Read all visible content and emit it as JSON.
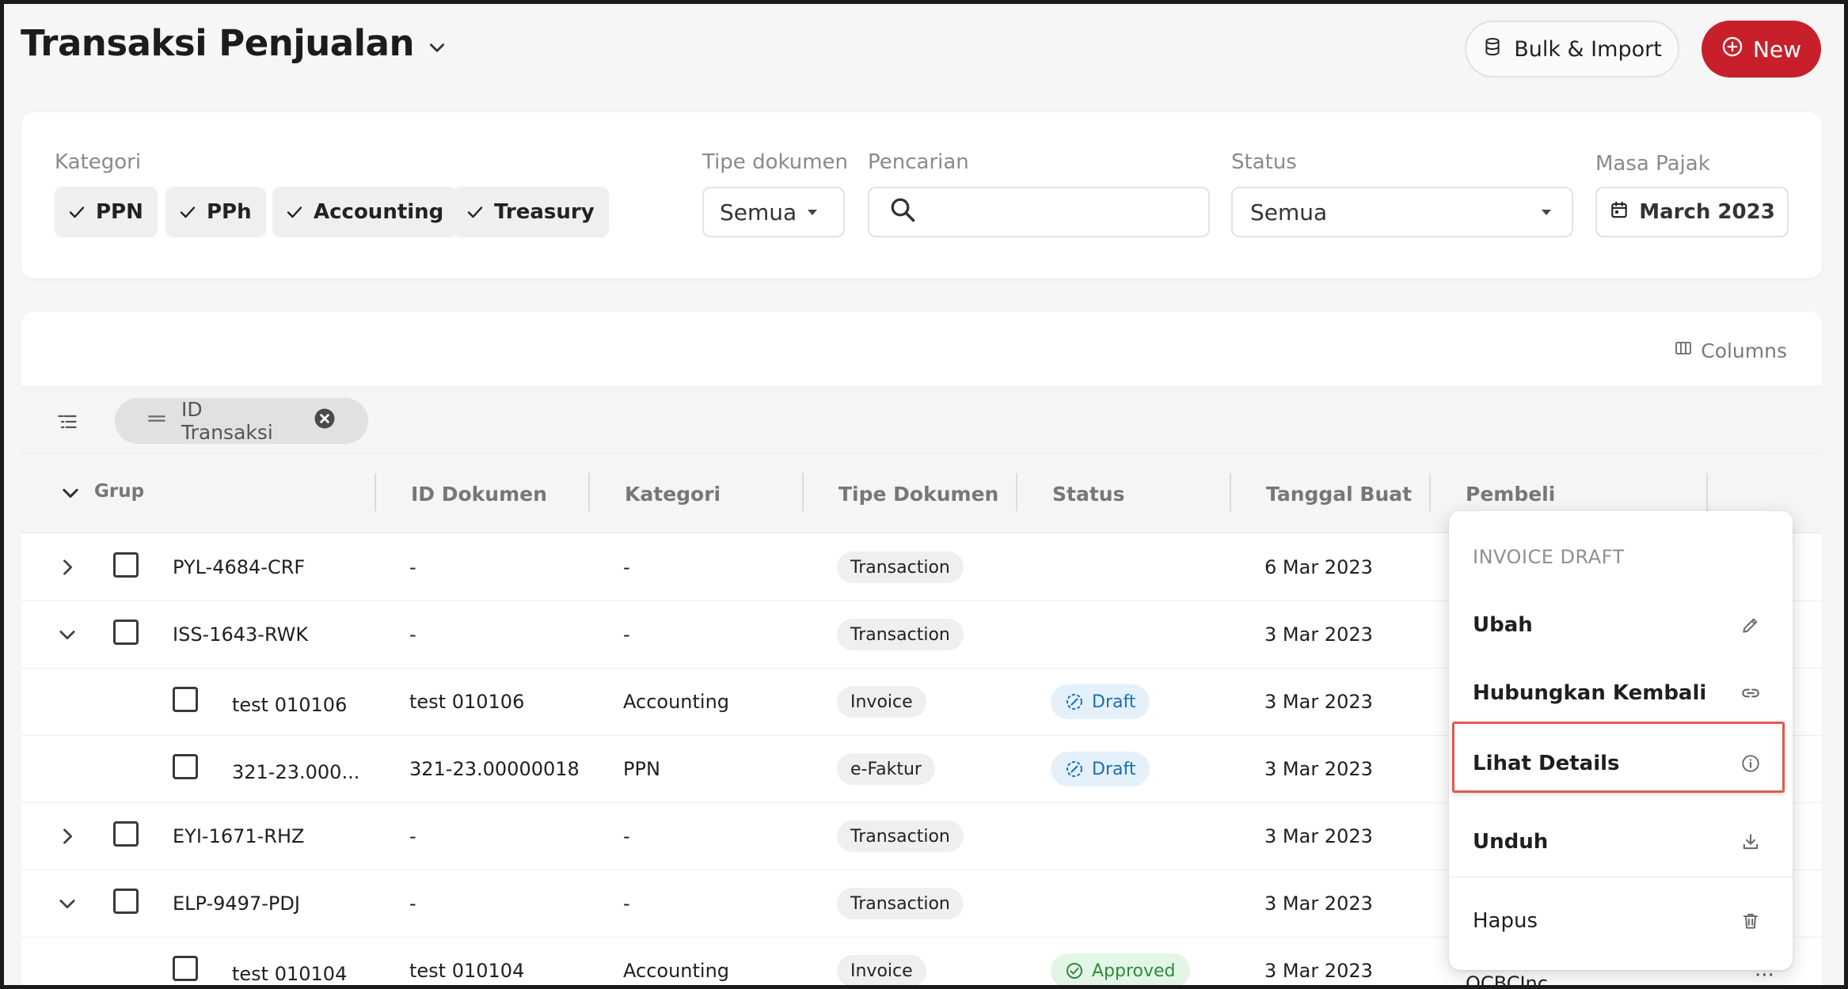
{
  "header": {
    "title": "Transaksi Penjualan",
    "bulk_label": "Bulk & Import",
    "new_label": "New"
  },
  "filters": {
    "kategori_label": "Kategori",
    "chips": [
      "PPN",
      "PPh",
      "Accounting",
      "Treasury"
    ],
    "tipe_label": "Tipe dokumen",
    "tipe_value": "Semua",
    "search_label": "Pencarian",
    "search_value": "",
    "status_label": "Status",
    "status_value": "Semua",
    "masa_label": "Masa Pajak",
    "masa_value": "March 2023"
  },
  "table": {
    "columns_label": "Columns",
    "group_chip": "ID Transaksi",
    "headers": {
      "grup": "Grup",
      "id_dokumen": "ID Dokumen",
      "kategori": "Kategori",
      "tipe": "Tipe Dokumen",
      "status": "Status",
      "tanggal": "Tanggal Buat",
      "pembeli": "Pembeli"
    },
    "rows": [
      {
        "group": "PYL-4684-CRF",
        "id": "-",
        "kategori": "-",
        "tipe": "Transaction",
        "status": "",
        "tanggal": "6 Mar 2023"
      },
      {
        "group": "ISS-1643-RWK",
        "id": "-",
        "kategori": "-",
        "tipe": "Transaction",
        "status": "",
        "tanggal": "3 Mar 2023"
      },
      {
        "group": "test 010106",
        "id": "test 010106",
        "kategori": "Accounting",
        "tipe": "Invoice",
        "status": "Draft",
        "tanggal": "3 Mar 2023"
      },
      {
        "group": "321-23.000...",
        "id": "321-23.00000018",
        "kategori": "PPN",
        "tipe": "e-Faktur",
        "status": "Draft",
        "tanggal": "3 Mar 2023"
      },
      {
        "group": "EYI-1671-RHZ",
        "id": "-",
        "kategori": "-",
        "tipe": "Transaction",
        "status": "",
        "tanggal": "3 Mar 2023"
      },
      {
        "group": "ELP-9497-PDJ",
        "id": "-",
        "kategori": "-",
        "tipe": "Transaction",
        "status": "",
        "tanggal": "3 Mar 2023"
      },
      {
        "group": "test 010104",
        "id": "test 010104",
        "kategori": "Accounting",
        "tipe": "Invoice",
        "status": "Approved",
        "tanggal": "3 Mar 2023",
        "pembeli": "OCBCInc"
      }
    ]
  },
  "menu": {
    "header": "INVOICE DRAFT",
    "items": [
      "Ubah",
      "Hubungkan Kembali",
      "Lihat Details",
      "Unduh",
      "Hapus"
    ]
  },
  "colors": {
    "primary": "#c8202b",
    "draft": "#1c6fb3",
    "approved": "#2e8b3d",
    "highlight": "#e05a4f"
  }
}
